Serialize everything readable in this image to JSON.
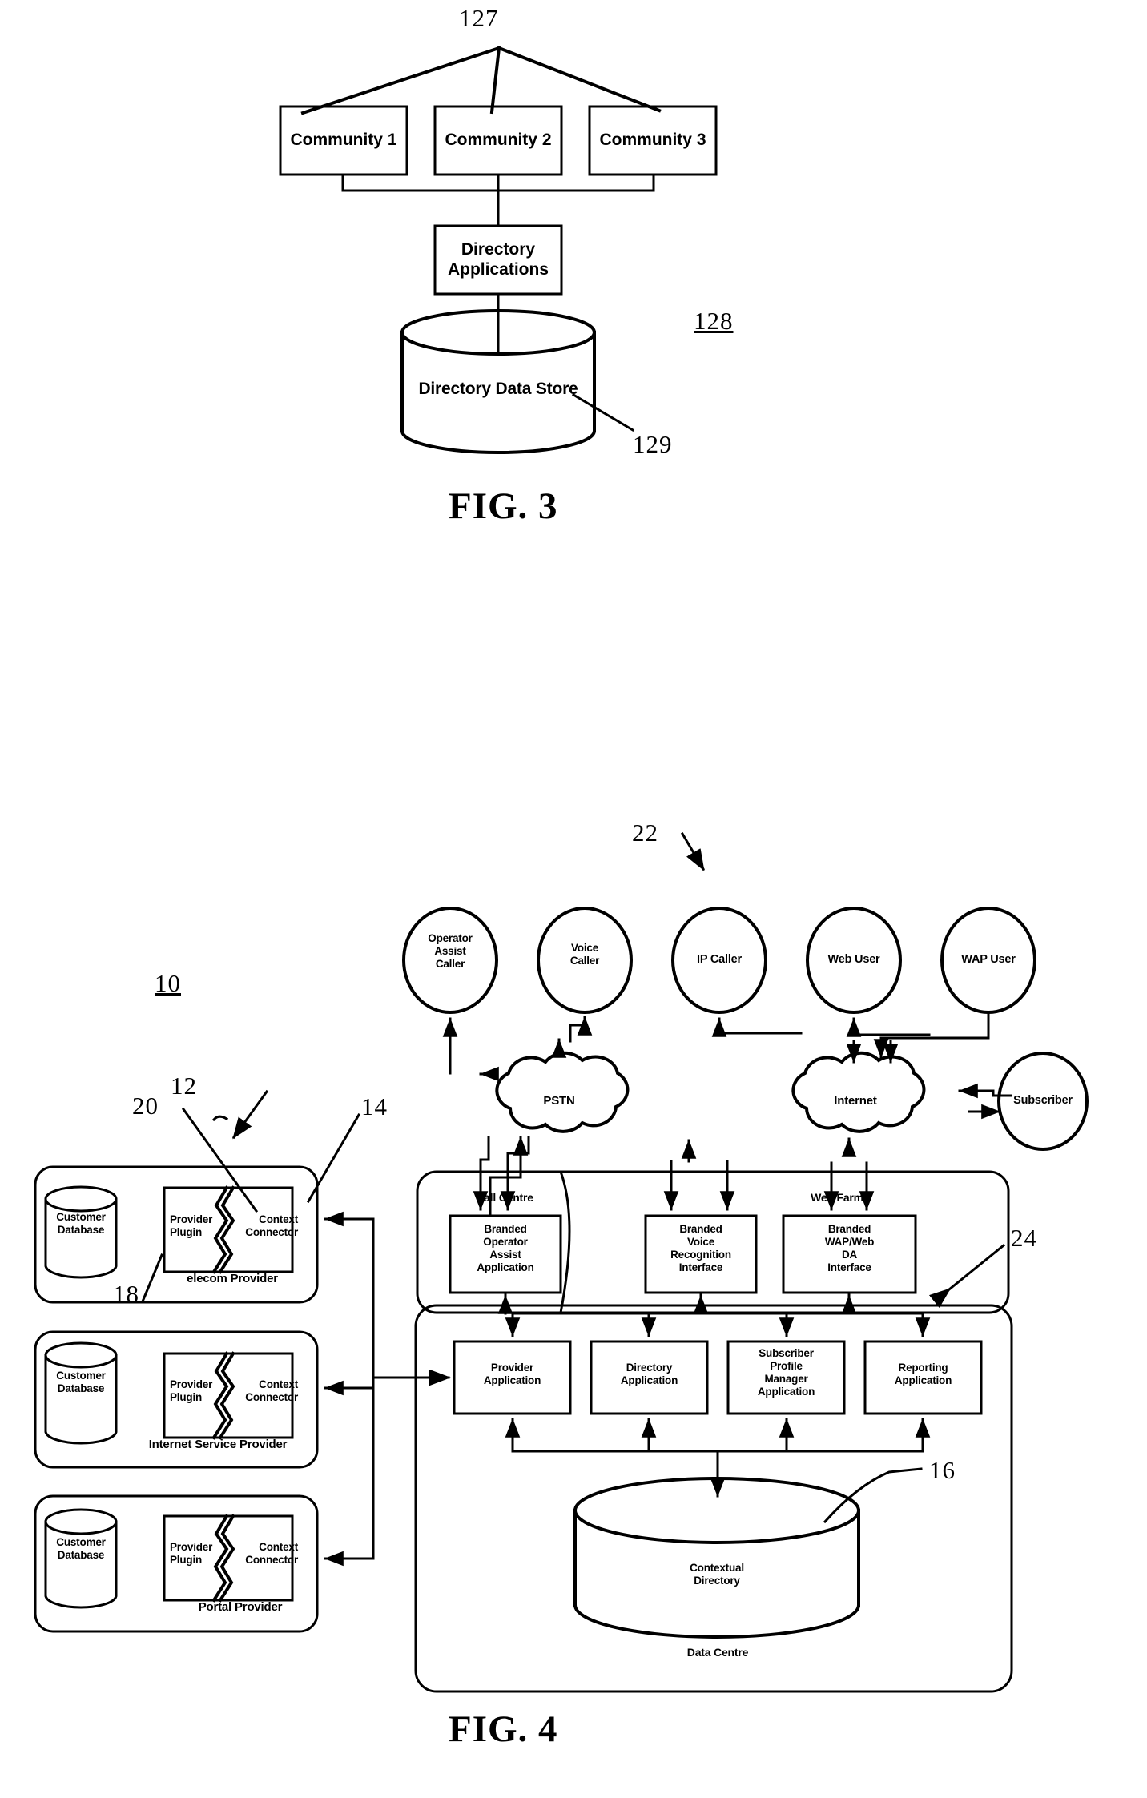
{
  "document": {
    "type": "patent-drawing-sheet",
    "figures": [
      "FIG. 3",
      "FIG. 4"
    ]
  },
  "fig3": {
    "title": "FIG. 3",
    "ref_top": "127",
    "ref_side": "128",
    "ref_store": "129",
    "communities": [
      {
        "label": "Community 1"
      },
      {
        "label": "Community 2"
      },
      {
        "label": "Community 3"
      }
    ],
    "directory_applications": "Directory\nApplications",
    "data_store": "Directory Data Store"
  },
  "fig4": {
    "title": "FIG. 4",
    "ref_system": "10",
    "ref_plugin_group": "12",
    "ref_provider_plugin": "20",
    "ref_context_connector": "14",
    "ref_users": "22",
    "ref_data_centre": "24",
    "ref_contextual_directory": "16",
    "ref_provider_panel": "18",
    "users": [
      {
        "label": "Operator\nAssist\nCaller"
      },
      {
        "label": "Voice\nCaller"
      },
      {
        "label": "IP Caller"
      },
      {
        "label": "Web User"
      },
      {
        "label": "WAP User"
      }
    ],
    "networks": [
      {
        "label": "PSTN"
      },
      {
        "label": "Internet"
      }
    ],
    "subscriber": "Subscriber",
    "group_labels": {
      "call_centre": "Call Centre",
      "web_farm": "Web Farm",
      "data_centre": "Data Centre"
    },
    "branded_apps": [
      {
        "label": "Branded\nOperator\nAssist\nApplication"
      },
      {
        "label": "Branded\nVoice\nRecognition\nInterface"
      },
      {
        "label": "Branded\nWAP/Web\nDA\nInterface"
      }
    ],
    "core_apps": [
      {
        "label": "Provider\nApplication"
      },
      {
        "label": "Directory\nApplication"
      },
      {
        "label": "Subscriber\nProfile\nManager\nApplication"
      },
      {
        "label": "Reporting\nApplication"
      }
    ],
    "contextual_directory": "Contextual\nDirectory",
    "providers": [
      {
        "database": "Customer\nDatabase",
        "plugin": "Provider\nPlugin",
        "connector": "Context\nConnector",
        "name": "elecom Provider"
      },
      {
        "database": "Customer\nDatabase",
        "plugin": "Provider\nPlugin",
        "connector": "Context\nConnector",
        "name": "Internet Service Provider"
      },
      {
        "database": "Customer\nDatabase",
        "plugin": "Provider\nPlugin",
        "connector": "Context\nConnector",
        "name": "Portal Provider"
      }
    ]
  },
  "colors": {
    "ink": "#000000",
    "paper": "#ffffff"
  }
}
